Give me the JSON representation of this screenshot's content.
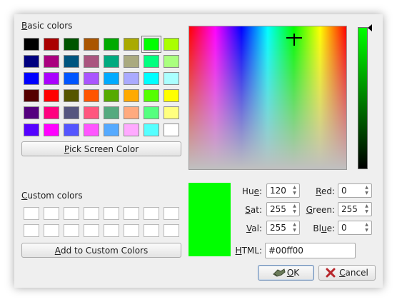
{
  "basic_colors": {
    "label_first": "B",
    "label_rest": "asic colors",
    "rows": [
      [
        "#000000",
        "#aa0000",
        "#005500",
        "#aa5500",
        "#00aa00",
        "#aaaa00",
        "#00ff00",
        "#aaff00"
      ],
      [
        "#00007f",
        "#aa007f",
        "#00557f",
        "#aa557f",
        "#00aa7f",
        "#aaaa7f",
        "#00ff7f",
        "#aaff7f"
      ],
      [
        "#0000ff",
        "#aa00ff",
        "#0055ff",
        "#aa55ff",
        "#00aaff",
        "#aaaaff",
        "#00ffff",
        "#aaffff"
      ],
      [
        "#550000",
        "#ff0000",
        "#555500",
        "#ff5500",
        "#55aa00",
        "#ffaa00",
        "#55ff00",
        "#ffff00"
      ],
      [
        "#55007f",
        "#ff007f",
        "#55557f",
        "#ff557f",
        "#55aa7f",
        "#ffaa7f",
        "#55ff7f",
        "#ffff7f"
      ],
      [
        "#5500ff",
        "#ff00ff",
        "#5555ff",
        "#ff55ff",
        "#55aaff",
        "#ffaaff",
        "#55ffff",
        "#ffffff"
      ]
    ],
    "selected_row": 0,
    "selected_col": 6
  },
  "pick_screen_button": {
    "first": "P",
    "rest": "ick Screen Color"
  },
  "custom_colors": {
    "label_first": "C",
    "label_rest": "ustom colors",
    "rows": 2,
    "cols": 8
  },
  "add_custom_button": {
    "first": "A",
    "rest": "dd to Custom Colors"
  },
  "current_color": "#00ff00",
  "fields": {
    "hue": {
      "label_pre": "Hu",
      "label_ul": "e",
      "label_post": ":",
      "value": "120"
    },
    "sat": {
      "label_pre": "",
      "label_ul": "S",
      "label_post": "at:",
      "value": "255"
    },
    "val": {
      "label_pre": "",
      "label_ul": "V",
      "label_post": "al:",
      "value": "255"
    },
    "red": {
      "label_pre": "",
      "label_ul": "R",
      "label_post": "ed:",
      "value": "0"
    },
    "green": {
      "label_pre": "",
      "label_ul": "G",
      "label_post": "reen:",
      "value": "255"
    },
    "blue": {
      "label_pre": "Bl",
      "label_ul": "u",
      "label_post": "e:",
      "value": "0"
    },
    "html": {
      "label_pre": "",
      "label_ul": "H",
      "label_post": "TML:",
      "value": "#00ff00"
    }
  },
  "ok_button": {
    "first": "O",
    "rest": "K",
    "icon": "ok-hand-icon"
  },
  "cancel_button": {
    "first": "C",
    "rest": "ancel",
    "icon": "cancel-x-icon"
  }
}
